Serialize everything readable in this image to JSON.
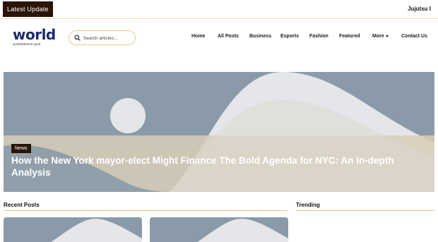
{
  "topbar": {
    "latest_label": "Latest Update",
    "ticker_text": "Jujutsu I"
  },
  "header": {
    "logo_text": "world",
    "logo_subtext": "worldofdeerns.ng.nl",
    "search_placeholder": "Search articles...",
    "nav": [
      {
        "label": "Home"
      },
      {
        "label": "All Posts"
      },
      {
        "label": "Business"
      },
      {
        "label": "Esports"
      },
      {
        "label": "Fashion"
      },
      {
        "label": "Featured"
      },
      {
        "label": "More"
      },
      {
        "label": "Contact Us"
      }
    ]
  },
  "hero": {
    "tag": "News",
    "title": "How the New York mayor-elect Might Finance The Bold Agenda for NYC: An In-depth Analysis"
  },
  "sections": {
    "recent_posts": "Recent Posts",
    "trending": "Trending"
  },
  "colors": {
    "accent_dark": "#2a1408",
    "border_accent": "#f0c58c",
    "placeholder_bg": "#8a9aa8",
    "placeholder_light": "#e4e6ea",
    "placeholder_sand": "#d8cdb8",
    "logo": "#1d2b6e"
  }
}
